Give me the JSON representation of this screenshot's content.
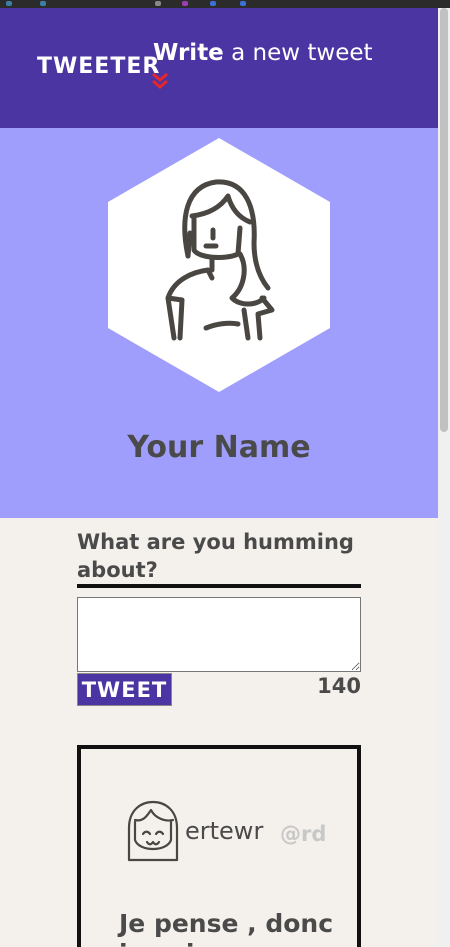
{
  "header": {
    "logo": "TWEETER",
    "title_strong": "Write",
    "title_rest": " a new tweet"
  },
  "profile": {
    "name": "Your Name",
    "avatar_icon": "woman-avatar-icon"
  },
  "compose": {
    "label": "What are you humming about?",
    "input_value": "",
    "button_label": "TWEET",
    "char_count": "140"
  },
  "tweet": {
    "avatar_icon": "smiling-girl-avatar-icon",
    "username": "ertewr",
    "handle": "@rd",
    "text": "Je pense , donc je suis"
  },
  "colors": {
    "header": "#4b35a3",
    "profile": "#9f9efd",
    "background": "#f4f1ec",
    "accent_red": "#e8252b"
  }
}
